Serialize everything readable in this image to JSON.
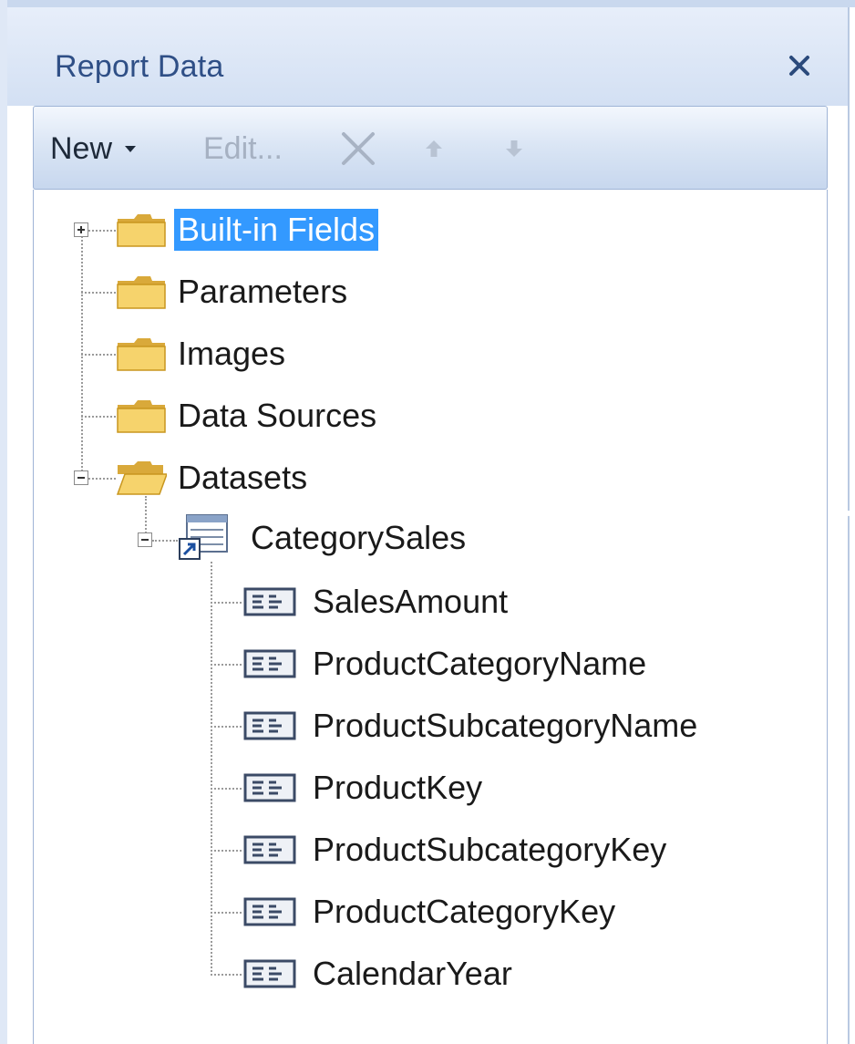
{
  "panel": {
    "title": "Report Data"
  },
  "toolbar": {
    "new_label": "New",
    "edit_label": "Edit...",
    "delete_icon": "delete-x-icon",
    "move_up_icon": "move-up-icon",
    "move_down_icon": "move-down-icon"
  },
  "tree": {
    "root_items": [
      {
        "label": "Built-in Fields",
        "icon": "folder-closed-icon",
        "expander": "plus",
        "selected": true
      },
      {
        "label": "Parameters",
        "icon": "folder-closed-icon"
      },
      {
        "label": "Images",
        "icon": "folder-closed-icon"
      },
      {
        "label": "Data Sources",
        "icon": "folder-closed-icon"
      },
      {
        "label": "Datasets",
        "icon": "folder-open-icon",
        "expander": "minus"
      }
    ],
    "dataset": {
      "label": "CategorySales",
      "icon": "dataset-shared-icon",
      "expander": "minus"
    },
    "fields": [
      "SalesAmount",
      "ProductCategoryName",
      "ProductSubcategoryName",
      "ProductKey",
      "ProductSubcategoryKey",
      "ProductCategoryKey",
      "CalendarYear"
    ]
  },
  "colors": {
    "selection": "#3399ff",
    "title": "#2f4f86",
    "disabled": "#a6b1c2"
  }
}
